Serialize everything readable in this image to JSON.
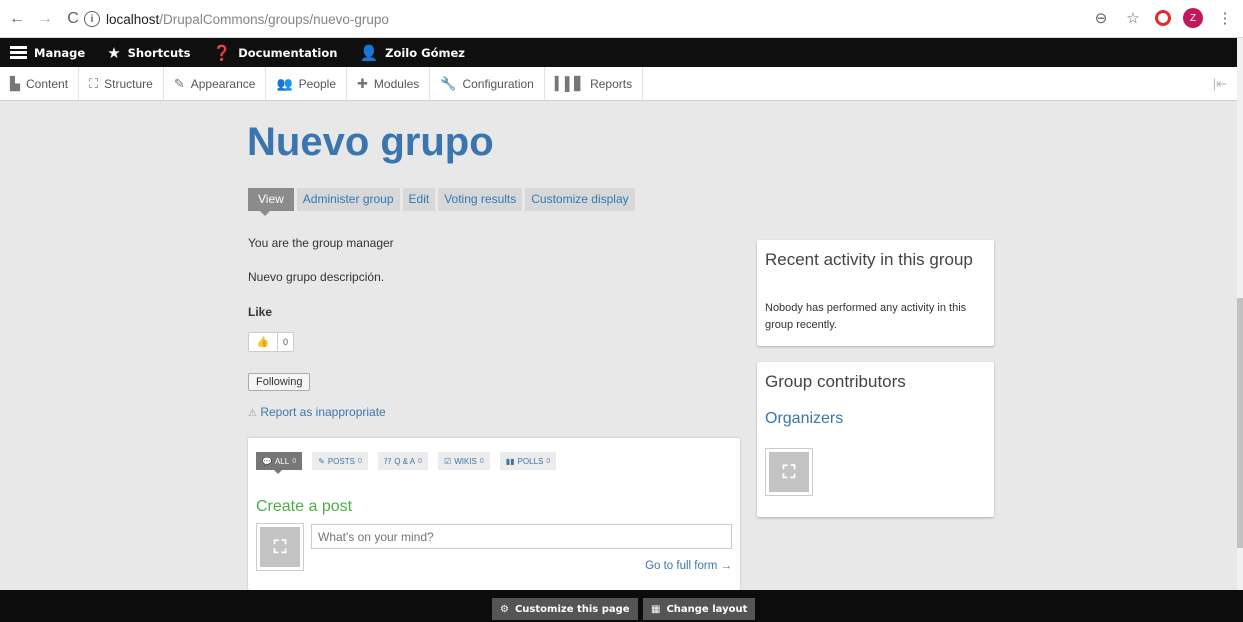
{
  "browser": {
    "url_host": "localhost",
    "url_path": "/DrupalCommons/groups/nuevo-grupo",
    "profile_initial": "Z"
  },
  "toolbar": {
    "manage": "Manage",
    "shortcuts": "Shortcuts",
    "documentation": "Documentation",
    "user": "Zoilo Gómez"
  },
  "tray": {
    "items": [
      "Content",
      "Structure",
      "Appearance",
      "People",
      "Modules",
      "Configuration",
      "Reports"
    ]
  },
  "page": {
    "title": "Nuevo grupo",
    "tabs": [
      "View",
      "Administer group",
      "Edit",
      "Voting results",
      "Customize display"
    ],
    "manager_text": "You are the group manager",
    "description": "Nuevo grupo descripción.",
    "like_label": "Like",
    "like_count": "0",
    "following_label": "Following",
    "report_label": "Report as inappropriate"
  },
  "feed": {
    "tabs": [
      {
        "label": "ALL",
        "count": "0"
      },
      {
        "label": "POSTS",
        "count": "0"
      },
      {
        "label": "Q & A",
        "count": "0"
      },
      {
        "label": "WIKIS",
        "count": "0"
      },
      {
        "label": "POLLS",
        "count": "0"
      }
    ],
    "create_post": "Create a post",
    "input_placeholder": "What's on your mind?",
    "full_form_link": "Go to full form →"
  },
  "sidebar": {
    "recent_title": "Recent activity in this group",
    "recent_text": "Nobody has performed any activity in this group recently.",
    "contrib_title": "Group contributors",
    "organizers": "Organizers"
  },
  "bottom": {
    "customize": "Customize this page",
    "change_layout": "Change layout"
  },
  "colors": {
    "link": "#3a76ad",
    "create_post": "#4ab043",
    "toolbar_bg": "#0f0f0f"
  }
}
